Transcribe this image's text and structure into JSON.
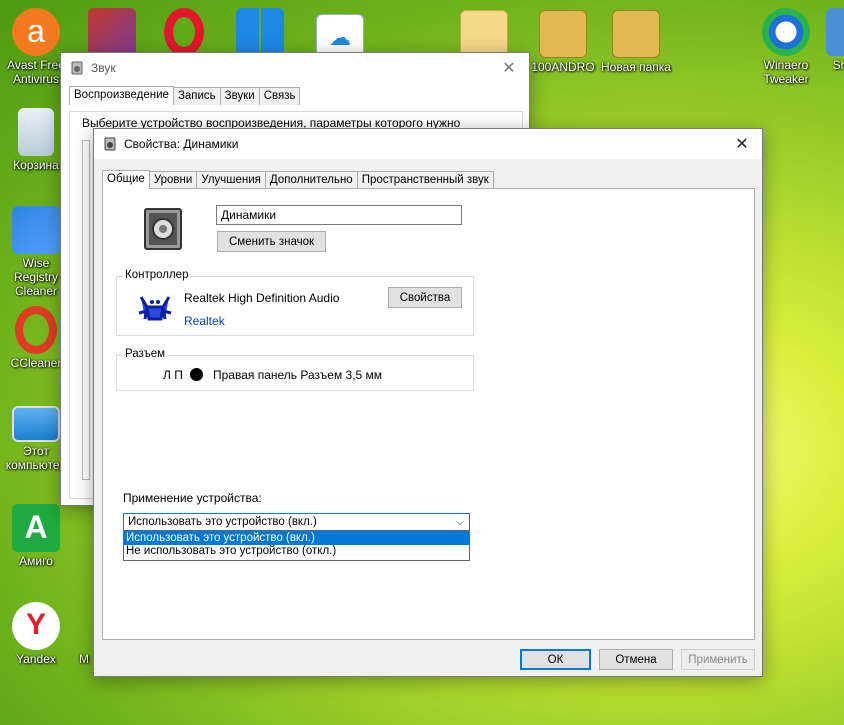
{
  "desktop": {
    "icons": [
      {
        "label": "Avast Free Antivirus",
        "icon": "avast-icon"
      },
      {
        "label": "",
        "icon": "winrar-tool-icon"
      },
      {
        "label": "",
        "icon": "opera-icon"
      },
      {
        "label": "",
        "icon": "windows-shield-icon"
      },
      {
        "label": "",
        "icon": "cloud-wifi-icon"
      },
      {
        "label": "",
        "icon": "folder-icon"
      },
      {
        "label": "100ANDRO",
        "icon": "folder-icon"
      },
      {
        "label": "Новая папка",
        "icon": "folder-icon"
      },
      {
        "label": "Winaero Tweaker",
        "icon": "winaero-icon"
      },
      {
        "label": "Sh",
        "icon": "app-icon"
      },
      {
        "label": "Корзина",
        "icon": "recycle-bin-icon"
      },
      {
        "label": "Wise Registry Cleaner",
        "icon": "wise-registry-icon"
      },
      {
        "label": "CCleaner",
        "icon": "ccleaner-icon"
      },
      {
        "label": "Этот компьютер",
        "icon": "computer-icon"
      },
      {
        "label": "Амиго",
        "icon": "amigo-icon"
      },
      {
        "label": "Yandex",
        "icon": "yandex-icon"
      },
      {
        "label": "M",
        "icon": "app-icon"
      }
    ]
  },
  "sound_window": {
    "title": "Звук",
    "tabs": [
      "Воспроизведение",
      "Запись",
      "Звуки",
      "Связь"
    ],
    "instruction": "Выберите устройство воспроизведения, параметры которого нужно"
  },
  "props_window": {
    "title": "Свойства: Динамики",
    "tabs": [
      "Общие",
      "Уровни",
      "Улучшения",
      "Дополнительно",
      "Пространственный звук"
    ],
    "device_name": "Динамики",
    "change_icon_label": "Сменить значок",
    "controller": {
      "legend": "Контроллер",
      "name": "Realtek High Definition Audio",
      "vendor": "Realtek",
      "properties_label": "Свойства"
    },
    "jack": {
      "legend": "Разъем",
      "channels": "Л П",
      "description": "Правая панель Разъем 3,5 мм"
    },
    "usage": {
      "label": "Применение устройства:",
      "selected": "Использовать это устройство (вкл.)",
      "options": [
        "Использовать это устройство (вкл.)",
        "Не использовать это устройство (откл.)"
      ]
    },
    "buttons": {
      "ok": "ОК",
      "cancel": "Отмена",
      "apply": "Применить"
    }
  }
}
